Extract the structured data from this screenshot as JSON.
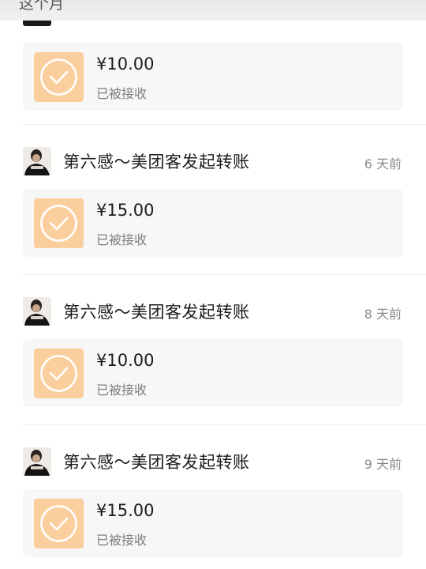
{
  "header": {
    "month_label": "这个月"
  },
  "records": [
    {
      "title": "",
      "time": "",
      "amount": "¥10.00",
      "status": "已被接收"
    },
    {
      "title": "第六感～美团客发起转账",
      "time": "6 天前",
      "amount": "¥15.00",
      "status": "已被接收"
    },
    {
      "title": "第六感～美团客发起转账",
      "time": "8 天前",
      "amount": "¥10.00",
      "status": "已被接收"
    },
    {
      "title": "第六感～美团客发起转账",
      "time": "9 天前",
      "amount": "¥15.00",
      "status": "已被接收"
    }
  ],
  "colors": {
    "icon_bg": "#fbcf9d",
    "card_bg": "#f7f7f7"
  },
  "icons": {
    "transfer": "check-circle-icon",
    "avatar": "avatar"
  }
}
